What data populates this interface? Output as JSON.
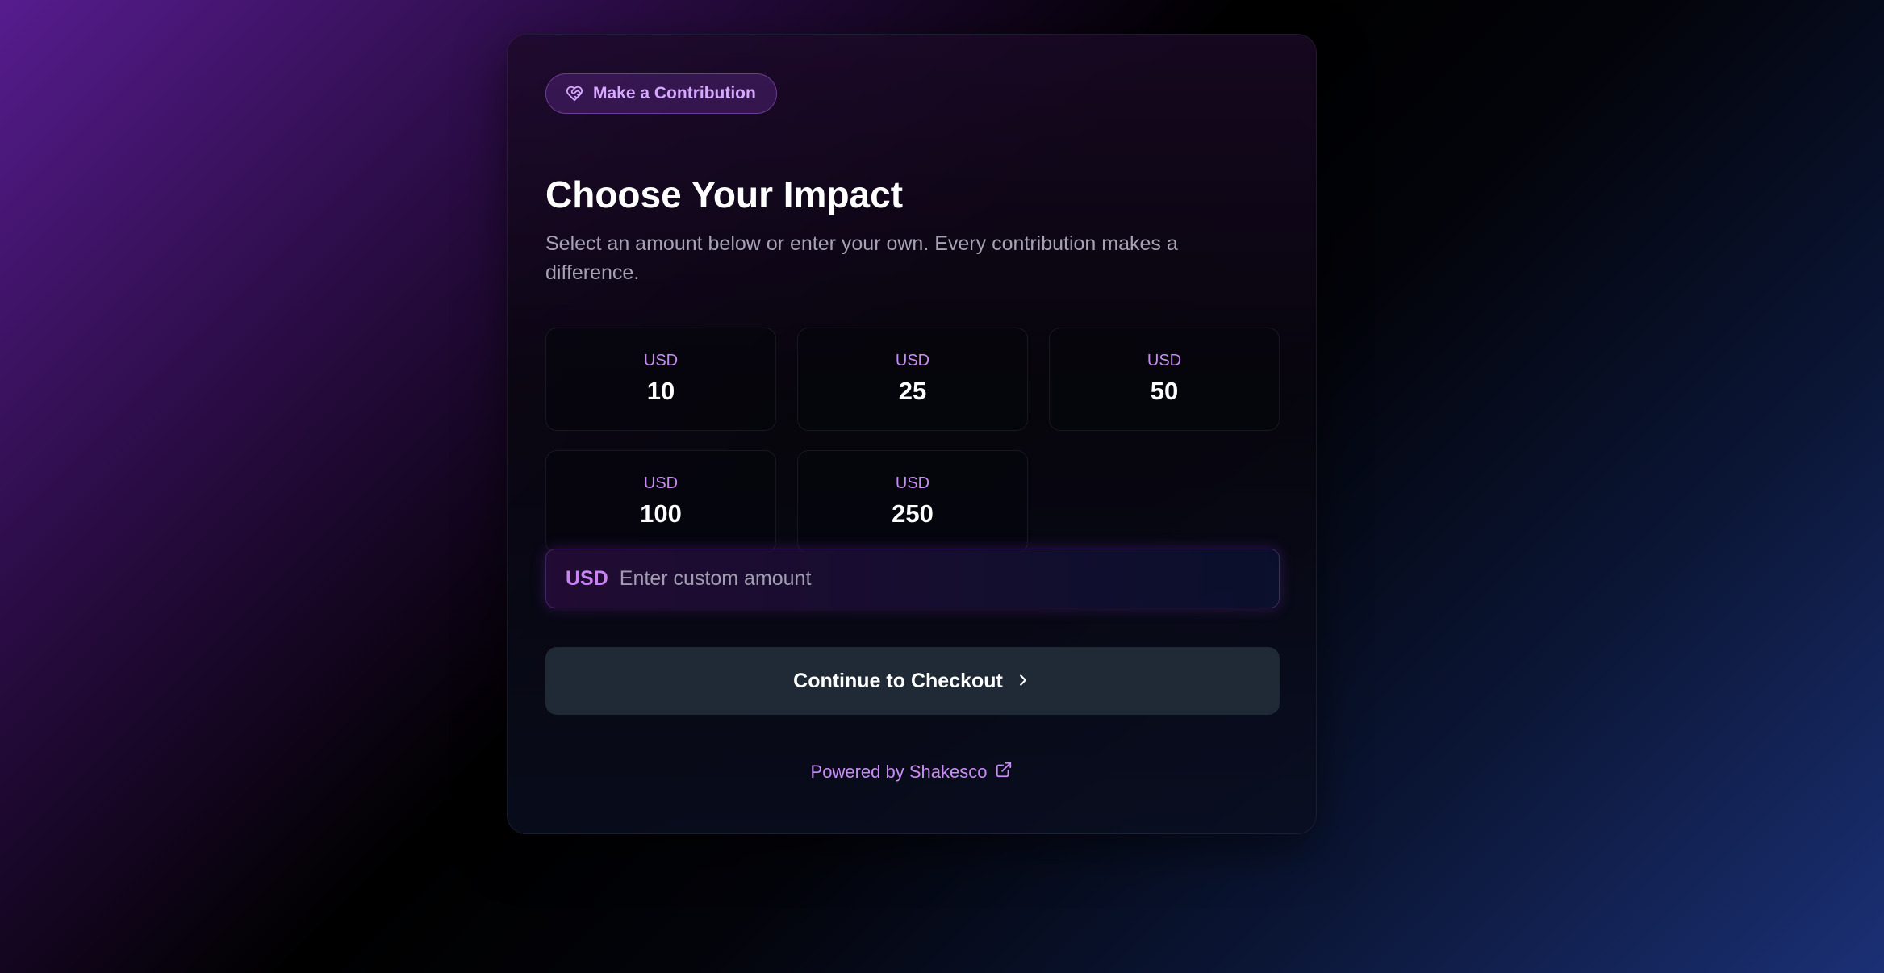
{
  "badge": {
    "icon": "heart-handshake-icon",
    "label": "Make a Contribution"
  },
  "heading": {
    "title": "Choose Your Impact",
    "subtitle": "Select an amount below or enter your own. Every contribution makes a difference."
  },
  "amounts": [
    {
      "currency": "USD",
      "value": "10"
    },
    {
      "currency": "USD",
      "value": "25"
    },
    {
      "currency": "USD",
      "value": "50"
    },
    {
      "currency": "USD",
      "value": "100"
    },
    {
      "currency": "USD",
      "value": "250"
    }
  ],
  "custom_amount": {
    "currency": "USD",
    "value": "",
    "placeholder": "Enter custom amount"
  },
  "checkout": {
    "label": "Continue to Checkout",
    "icon": "chevron-right-icon"
  },
  "footer": {
    "label": "Powered by Shakesco",
    "icon": "external-link-icon"
  },
  "colors": {
    "accent": "#c98cf5",
    "button_bg": "#202a36",
    "text_primary": "#ffffff",
    "text_muted": "#a6a2b4"
  }
}
